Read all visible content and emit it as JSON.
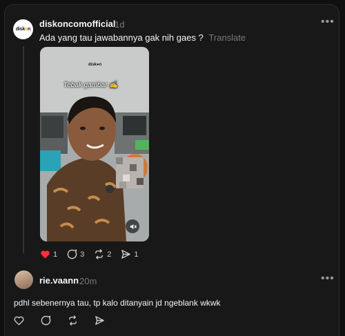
{
  "post": {
    "username": "diskoncomofficial",
    "time": "1d",
    "caption": "Ada yang tau jawabannya gak nih gaes ?",
    "translate_label": "Translate",
    "avatar_logo_a": "disk",
    "avatar_logo_b": "o",
    "avatar_logo_c": "n",
    "media": {
      "overlay_text": "Tebak gambar ✍",
      "watermark": "disk●n"
    },
    "actions": {
      "like_count": "1",
      "comment_count": "3",
      "repost_count": "2",
      "share_count": "1"
    },
    "colors": {
      "liked": "#ff3040",
      "muted_text": "#777777"
    }
  },
  "reply": {
    "username": "rie.vaann",
    "time": "20m",
    "text": "pdhl sebenernya tau, tp kalo ditanyain jd ngeblank wkwk"
  },
  "icons": [
    "heart-icon",
    "comment-icon",
    "repost-icon",
    "share-icon",
    "more-icon",
    "mute-icon"
  ]
}
